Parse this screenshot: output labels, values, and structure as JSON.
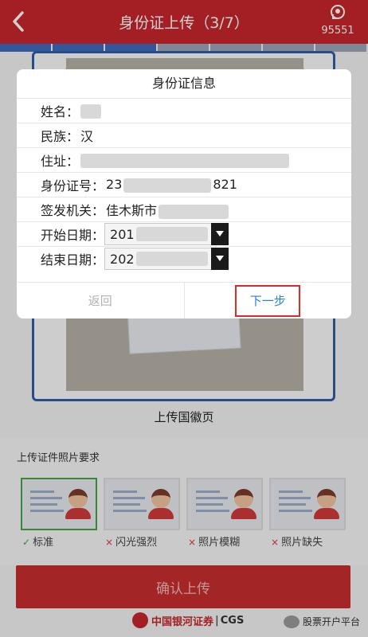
{
  "header": {
    "title": "身份证上传（3/7）",
    "hotline": "95551"
  },
  "upload_label": "上传国徽页",
  "requirements": {
    "title": "上传证件照片要求",
    "items": [
      {
        "label": "标准",
        "mark": "✓"
      },
      {
        "label": "闪光强烈",
        "mark": "×"
      },
      {
        "label": "照片模糊",
        "mark": "×"
      },
      {
        "label": "照片缺失",
        "mark": "×"
      }
    ]
  },
  "confirm_label": "确认上传",
  "footer": {
    "brand": "中国银河证券",
    "cgs": "CGS",
    "watermark": "股票开户平台"
  },
  "modal": {
    "title": "身份证信息",
    "fields": {
      "name": "姓名：",
      "ethnicity": "民族：",
      "ethnicity_value": "汉",
      "address": "住址：",
      "id": "身份证号：",
      "id_prefix": "23",
      "id_suffix": "821",
      "authority": "签发机关：",
      "authority_value": "佳木斯市",
      "start": "开始日期：",
      "start_value": "201",
      "end": "结束日期：",
      "end_value": "202"
    },
    "back_label": "返回",
    "next_label": "下一步"
  }
}
